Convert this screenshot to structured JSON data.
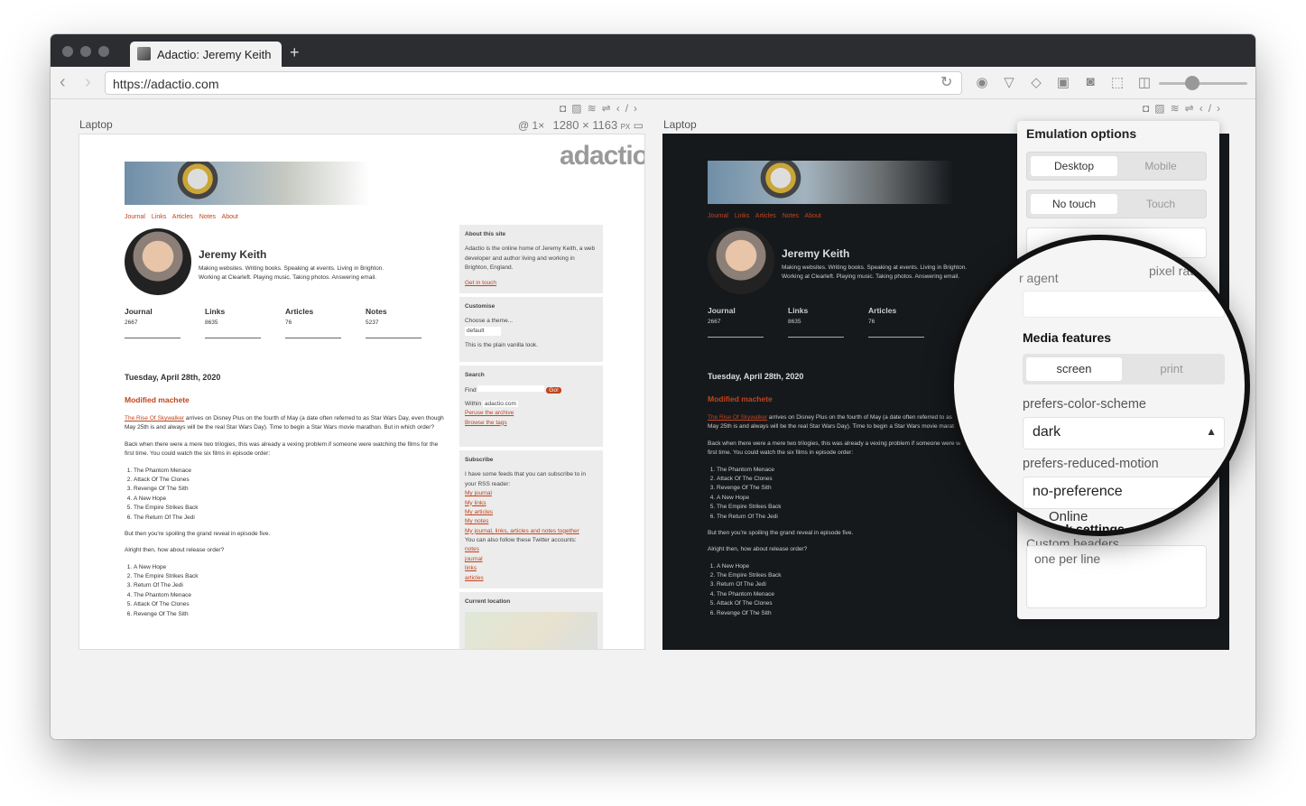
{
  "browser": {
    "tab_title": "Adactio: Jeremy Keith",
    "new_tab": "+",
    "url": "https://adactio.com"
  },
  "panes": {
    "left_label": "Laptop",
    "right_label": "Laptop",
    "scale": "@ 1×",
    "dimensions": "1280 × 1163",
    "unit": "PX"
  },
  "site": {
    "logo": "adactio",
    "nav": "Journal Links Articles Notes About",
    "name": "Jeremy Keith",
    "bio_line1": "Making websites. Writing books. Speaking at events. Living in Brighton.",
    "bio_line2": "Working at Clearleft. Playing music. Taking photos. Answering email.",
    "stats": [
      {
        "label": "Journal",
        "count": "2667"
      },
      {
        "label": "Links",
        "count": "8635"
      },
      {
        "label": "Articles",
        "count": "76"
      },
      {
        "label": "Notes",
        "count": "5237"
      }
    ],
    "date": "Tuesday, April 28th, 2020",
    "post_title": "Modified machete",
    "para1_link": "The Rise Of Skywalker",
    "para1": " arrives on Disney Plus on the fourth of May (a date often referred to as Star Wars Day, even though May 25th is and always will be the real Star Wars Day). Time to begin a Star Wars movie marathon. But in which order?",
    "para2": "Back when there were a mere two trilogies, this was already a vexing problem if someone were watching the films for the first time. You could watch the six films in episode order:",
    "list1": [
      "The Phantom Menace",
      "Attack Of The Clones",
      "Revenge Of The Sith",
      "A New Hope",
      "The Empire Strikes Back",
      "The Return Of The Jedi"
    ],
    "para3": "But then you're spoiling the grand reveal in episode five.",
    "para4": "Alright then, how about release order?",
    "list2": [
      "A New Hope",
      "The Empire Strikes Back",
      "Return Of The Jedi",
      "The Phantom Menace",
      "Attack Of The Clones",
      "Revenge Of The Sith"
    ]
  },
  "sidebar": {
    "about_title": "About this site",
    "about_text": "Adactio is the online home of Jeremy Keith, a web developer and author living and working in Brighton, England.",
    "about_link": "Get in touch",
    "customise_title": "Customise",
    "customise_text": "Choose a theme...",
    "theme_value": "default",
    "customise_note": "This is the plain vanilla look.",
    "search_title": "Search",
    "find_label": "Find",
    "go_label": "Go!",
    "within_label": "Within",
    "within_value": "adactio.com",
    "search_links": [
      "Peruse the archive",
      "Browse the tags"
    ],
    "subscribe_title": "Subscribe",
    "subscribe_text": "I have some feeds that you can subscribe to in your RSS reader:",
    "feeds": [
      "My journal",
      "My links",
      "My articles",
      "My notes",
      "My journal, links, articles and notes together"
    ],
    "twitter_text": "You can also follow these Twitter accounts:",
    "twitter": [
      "notes",
      "journal",
      "links",
      "articles"
    ],
    "location_title": "Current location"
  },
  "emulation": {
    "title": "Emulation options",
    "device": {
      "on": "Desktop",
      "off": "Mobile"
    },
    "touch": {
      "on": "No touch",
      "off": "Touch"
    },
    "pixel_ratio_label": "pixel ratio",
    "user_agent_label": "r agent",
    "media_features": "Media features",
    "media": {
      "on": "screen",
      "off": "print"
    },
    "color_scheme_label": "prefers-color-scheme",
    "color_scheme_value": "dark",
    "reduced_motion_label": "prefers-reduced-motion",
    "reduced_motion_value": "no-preference",
    "network_settings": "Network settings",
    "network_value": "Online",
    "custom_headers_label": "Custom headers",
    "custom_headers_placeholder": "one per line"
  }
}
